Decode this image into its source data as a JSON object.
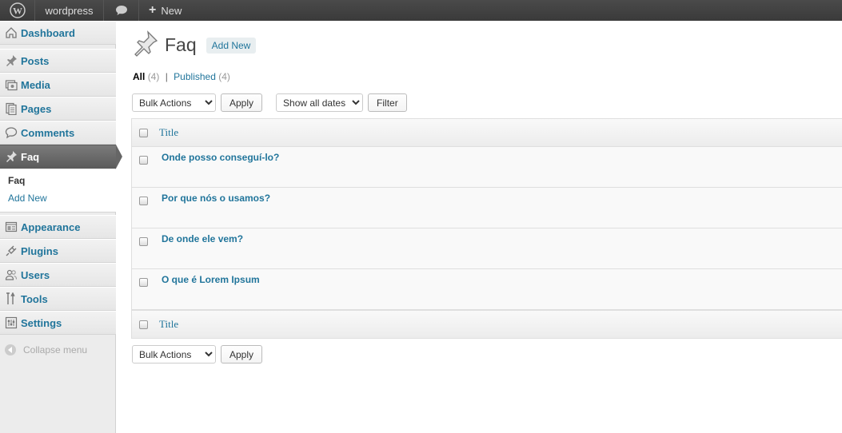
{
  "adminbar": {
    "wp_logo_icon": "wordpress-logo-icon",
    "site_name": "wordpress",
    "comments_icon": "speech-bubble-icon",
    "new_label": "New"
  },
  "sidebar": {
    "items": [
      {
        "label": "Dashboard",
        "icon": "dashboard-icon"
      },
      {
        "label": "Posts",
        "icon": "pushpin-icon"
      },
      {
        "label": "Media",
        "icon": "media-icon"
      },
      {
        "label": "Pages",
        "icon": "pages-icon"
      },
      {
        "label": "Comments",
        "icon": "comment-icon"
      },
      {
        "label": "Faq",
        "icon": "pushpin-icon"
      },
      {
        "label": "Appearance",
        "icon": "appearance-icon"
      },
      {
        "label": "Plugins",
        "icon": "plugin-icon"
      },
      {
        "label": "Users",
        "icon": "users-icon"
      },
      {
        "label": "Tools",
        "icon": "tools-icon"
      },
      {
        "label": "Settings",
        "icon": "settings-icon"
      }
    ],
    "submenu": {
      "current": "Faq",
      "add_new": "Add New"
    },
    "collapse_label": "Collapse menu"
  },
  "main": {
    "title": "Faq",
    "add_new": "Add New",
    "filters": {
      "all_label": "All",
      "all_count": "(4)",
      "separator": "|",
      "published_label": "Published",
      "published_count": "(4)"
    },
    "bulk_actions": "Bulk Actions",
    "apply": "Apply",
    "dates": "Show all dates",
    "filter": "Filter",
    "table": {
      "column_title": "Title",
      "rows": [
        "Onde posso conseguí-lo?",
        "Por que nós o usamos?",
        "De onde ele vem?",
        "O que é Lorem Ipsum"
      ]
    }
  },
  "colors": {
    "link": "#21759b",
    "adminbar": "#464646",
    "sidebar": "#ececec",
    "current_menu": "#6d6d6d"
  }
}
